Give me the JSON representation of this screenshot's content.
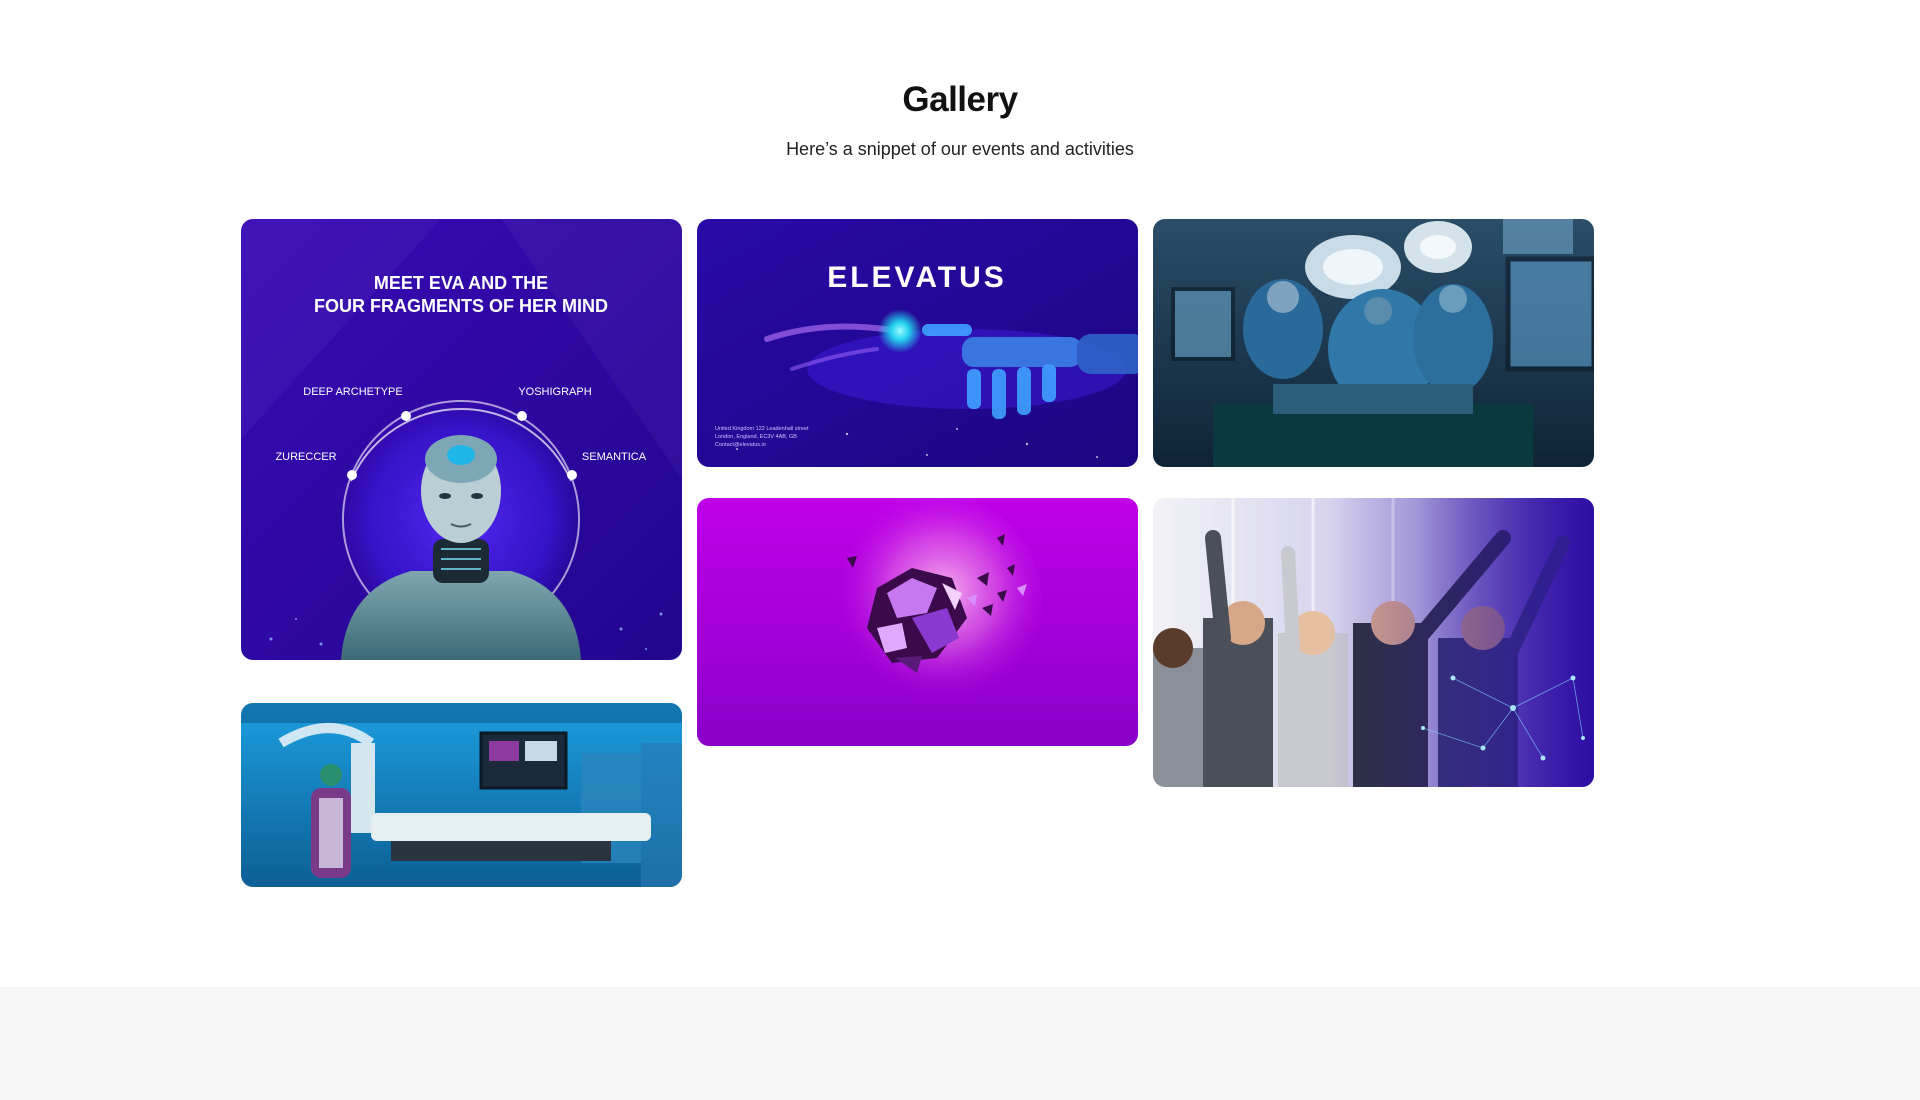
{
  "gallery": {
    "title": "Gallery",
    "subtitle": "Here’s a snippet of our events and activities"
  },
  "cards": {
    "eva": {
      "headline_1": "MEET EVA AND THE",
      "headline_2": "FOUR FRAGMENTS OF HER MIND",
      "fragments": [
        "DEEP ARCHETYPE",
        "YOSHIGRAPH",
        "ZURECCER",
        "SEMANTICA"
      ]
    },
    "elevatus": {
      "logo": "ELEVATUS",
      "address_1": "United Kingdom 122 Leadenhall street",
      "address_2": "London, England, EC3V 4AB, GB",
      "address_3": "Contact@elevatus.io"
    }
  },
  "colors": {
    "accent_purple": "#2a0aa8",
    "magenta": "#b400e0",
    "footer_bg": "#f7f7f7"
  }
}
